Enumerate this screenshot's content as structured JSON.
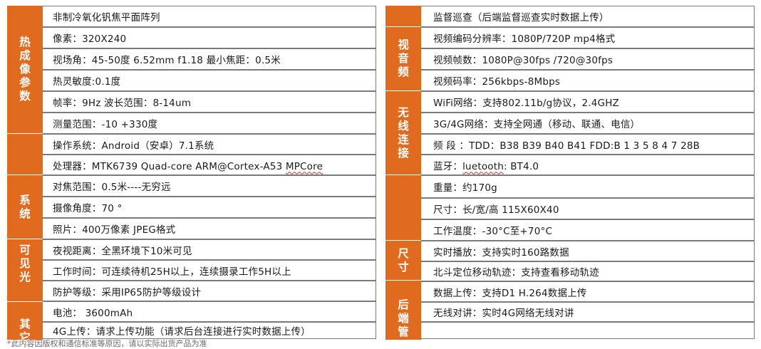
{
  "left": {
    "categories": [
      "热成像参数",
      "系统",
      "可见光",
      "其它"
    ],
    "rows": [
      {
        "text": "非制冷氧化钒焦平面阵列"
      },
      {
        "text": "像素：320X240"
      },
      {
        "text": "视场角：45-50度 6.52mm f1.18 最小焦距：0.5米"
      },
      {
        "text": "热灵敏度:0.1度"
      },
      {
        "text": "帧率：9Hz 波长范围：8-14um"
      },
      {
        "text": "测量范围：-10 +330度"
      },
      {
        "text": "操作系统：Android（安卓）7.1系统"
      },
      {
        "text_a": "处理器：MTK6739 Quad-core ARM@Cortex-A53 ",
        "text_b": "MPCore"
      },
      {
        "text": "对焦范围：0.5米----无穷远"
      },
      {
        "text": "摄像角度：70 °"
      },
      {
        "text": "照片：400万像素 JPEG格式"
      },
      {
        "text": "夜视距离：全黑环境下10米可见"
      },
      {
        "text": "工作时间：可连续待机25H以上，连续摄录工作5H以上"
      },
      {
        "text": "防护等级：采用IP65防护等级设计"
      },
      {
        "text": "电池： 3600mAh"
      },
      {
        "text": "4G上传：请求上传功能（请求后台连接进行实时数据上传）"
      }
    ]
  },
  "right": {
    "categories": [
      "视音频",
      "无线连接",
      "尺寸",
      "后端管"
    ],
    "rows": [
      {
        "text": "监督巡查（后端监督巡查实时数据上传）"
      },
      {
        "text": "视频编码分辨率：1080P/720P mp4格式"
      },
      {
        "text": "视频帧数：1080P@30fps /720@30fps"
      },
      {
        "text": "视频码率：256kbps-8Mbps"
      },
      {
        "text": "WiFi网络：支持802.11b/g协议，2.4GHZ"
      },
      {
        "text": "3G/4G网络：支持全网通（移动、联通、电信）"
      },
      {
        "text": "频 段 ：TDD：B38 B39 B40 B41 FDD:B 1 3 5 8 4 7 28B"
      },
      {
        "text_a": "蓝牙：",
        "text_b": "luetooth",
        "text_c": ": BT4.0"
      },
      {
        "text": "重量：约170g"
      },
      {
        "text": "尺寸：长/宽/高 115X60X40"
      },
      {
        "text": "工作温度：-30°C至+70°C"
      },
      {
        "text": "实时播放：支持实时160路数据"
      },
      {
        "text": "北斗定位移动轨迹：支持查看移动轨迹"
      },
      {
        "text": "数据上传：支持D1 H.264数据上传"
      },
      {
        "text": "无线对讲：实时4G网络无线对讲"
      },
      {
        "text": ""
      }
    ]
  },
  "footnote": "*此内容因版权和通信标准等原因，请以实际出货产品为准"
}
